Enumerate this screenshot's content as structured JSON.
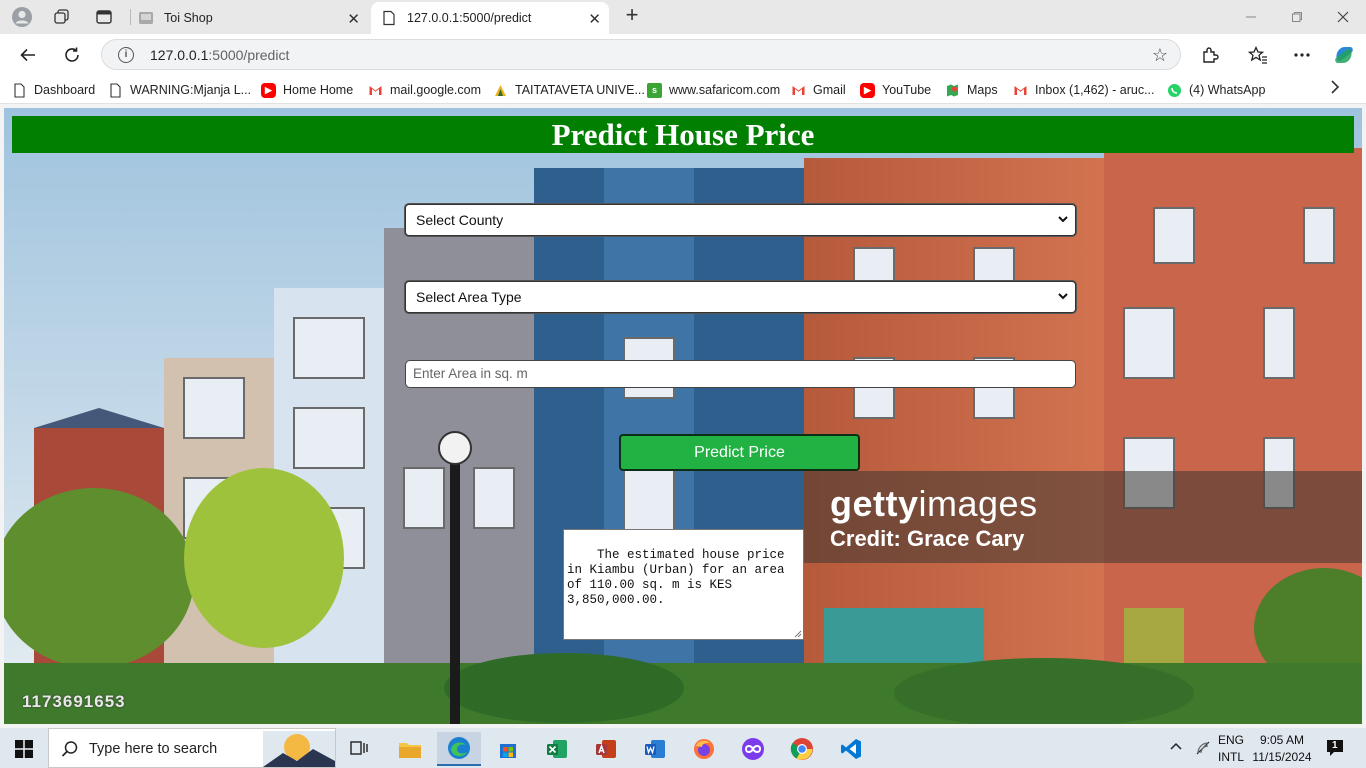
{
  "browser": {
    "tabs": [
      {
        "title": "Toi Shop",
        "active": false
      },
      {
        "title": "127.0.0.1:5000/predict",
        "active": true
      }
    ],
    "address": {
      "host": "127.0.0.1",
      "path": ":5000/predict"
    },
    "bookmarks": [
      {
        "label": "Dashboard",
        "icon": "page-icon"
      },
      {
        "label": "WARNING:Mjanja L...",
        "icon": "page-icon"
      },
      {
        "label": "Home Home",
        "icon": "youtube-icon"
      },
      {
        "label": "mail.google.com",
        "icon": "gmail-icon"
      },
      {
        "label": "TAITATAVETA UNIVE...",
        "icon": "university-icon"
      },
      {
        "label": "www.safaricom.com",
        "icon": "safaricom-icon"
      },
      {
        "label": "Gmail",
        "icon": "gmail-icon"
      },
      {
        "label": "YouTube",
        "icon": "youtube-icon"
      },
      {
        "label": "Maps",
        "icon": "maps-icon"
      },
      {
        "label": "Inbox (1,462) - aruc...",
        "icon": "gmail-icon"
      },
      {
        "label": "(4) WhatsApp",
        "icon": "whatsapp-icon"
      }
    ]
  },
  "page": {
    "title": "Predict House Price",
    "county_select": "Select County",
    "area_type_select": "Select Area Type",
    "area_placeholder": "Enter Area in sq. m",
    "predict_button": "Predict Price",
    "result_text": "The estimated house price in Kiambu (Urban) for an area of 110.00 sq. m is KES 3,850,000.00.",
    "watermark": {
      "brand_light": "getty",
      "brand_bold": "images",
      "credit": "Credit: Grace Cary",
      "image_id": "1173691653"
    }
  },
  "taskbar": {
    "search_placeholder": "Type here to search",
    "lang_top": "ENG",
    "lang_bottom": "INTL",
    "time": "9:05 AM",
    "date": "11/15/2024",
    "notification_count": "1"
  },
  "colors": {
    "header_green": "#007f00",
    "button_green": "#22b244"
  }
}
